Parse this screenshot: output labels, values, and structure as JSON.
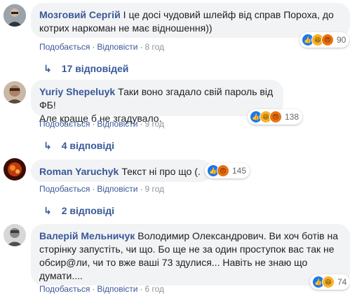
{
  "comments": [
    {
      "author": "Мозговий Сергій",
      "text_lines": [
        "І це досі чудовий шлейф від справ Пороха, до",
        "котрих наркоман не має відношення))"
      ],
      "like_label": "Подобається",
      "reply_label": "Відповісти",
      "time": "8 год",
      "reactions": [
        "like-icon",
        "haha-icon",
        "angry-icon"
      ],
      "reaction_count": "90",
      "replies_label": "17 відповідей"
    },
    {
      "author": "Yuriy Shepeluyk",
      "text_lines": [
        "Таки воно згадало свій пароль від ФБ!",
        "Але краще б не згадувало."
      ],
      "like_label": "Подобається",
      "reply_label": "Відповісти",
      "time": "9 год",
      "reactions": [
        "like-icon",
        "haha-icon",
        "angry-icon"
      ],
      "reaction_count": "138",
      "replies_label": "4 відповіді"
    },
    {
      "author": "Roman Yaruchyk",
      "text_lines": [
        "Текст ні про що (."
      ],
      "like_label": "Подобається",
      "reply_label": "Відповісти",
      "time": "9 год",
      "reactions": [
        "like-icon",
        "angry-icon"
      ],
      "reaction_count": "145",
      "replies_label": "2 відповіді"
    },
    {
      "author": "Валерій Мельничук",
      "text_lines": [
        "Володимир Олександрович. Ви хоч ботів на",
        "сторінку запустіть, чи що. Бо ще не за один проступок вас так не",
        "обсир@ли, чи то вже ваші 73 здулися... Навіть не знаю що",
        "думати...."
      ],
      "like_label": "Подобається",
      "reply_label": "Відповісти",
      "time": "6 год",
      "reactions": [
        "like-icon",
        "haha-icon"
      ],
      "reaction_count": "74"
    }
  ],
  "colors": {
    "link": "#385898",
    "bubble": "#f2f3f5",
    "like": "#1877f2",
    "haha": "#f7b125",
    "angry": "#e9710f"
  }
}
